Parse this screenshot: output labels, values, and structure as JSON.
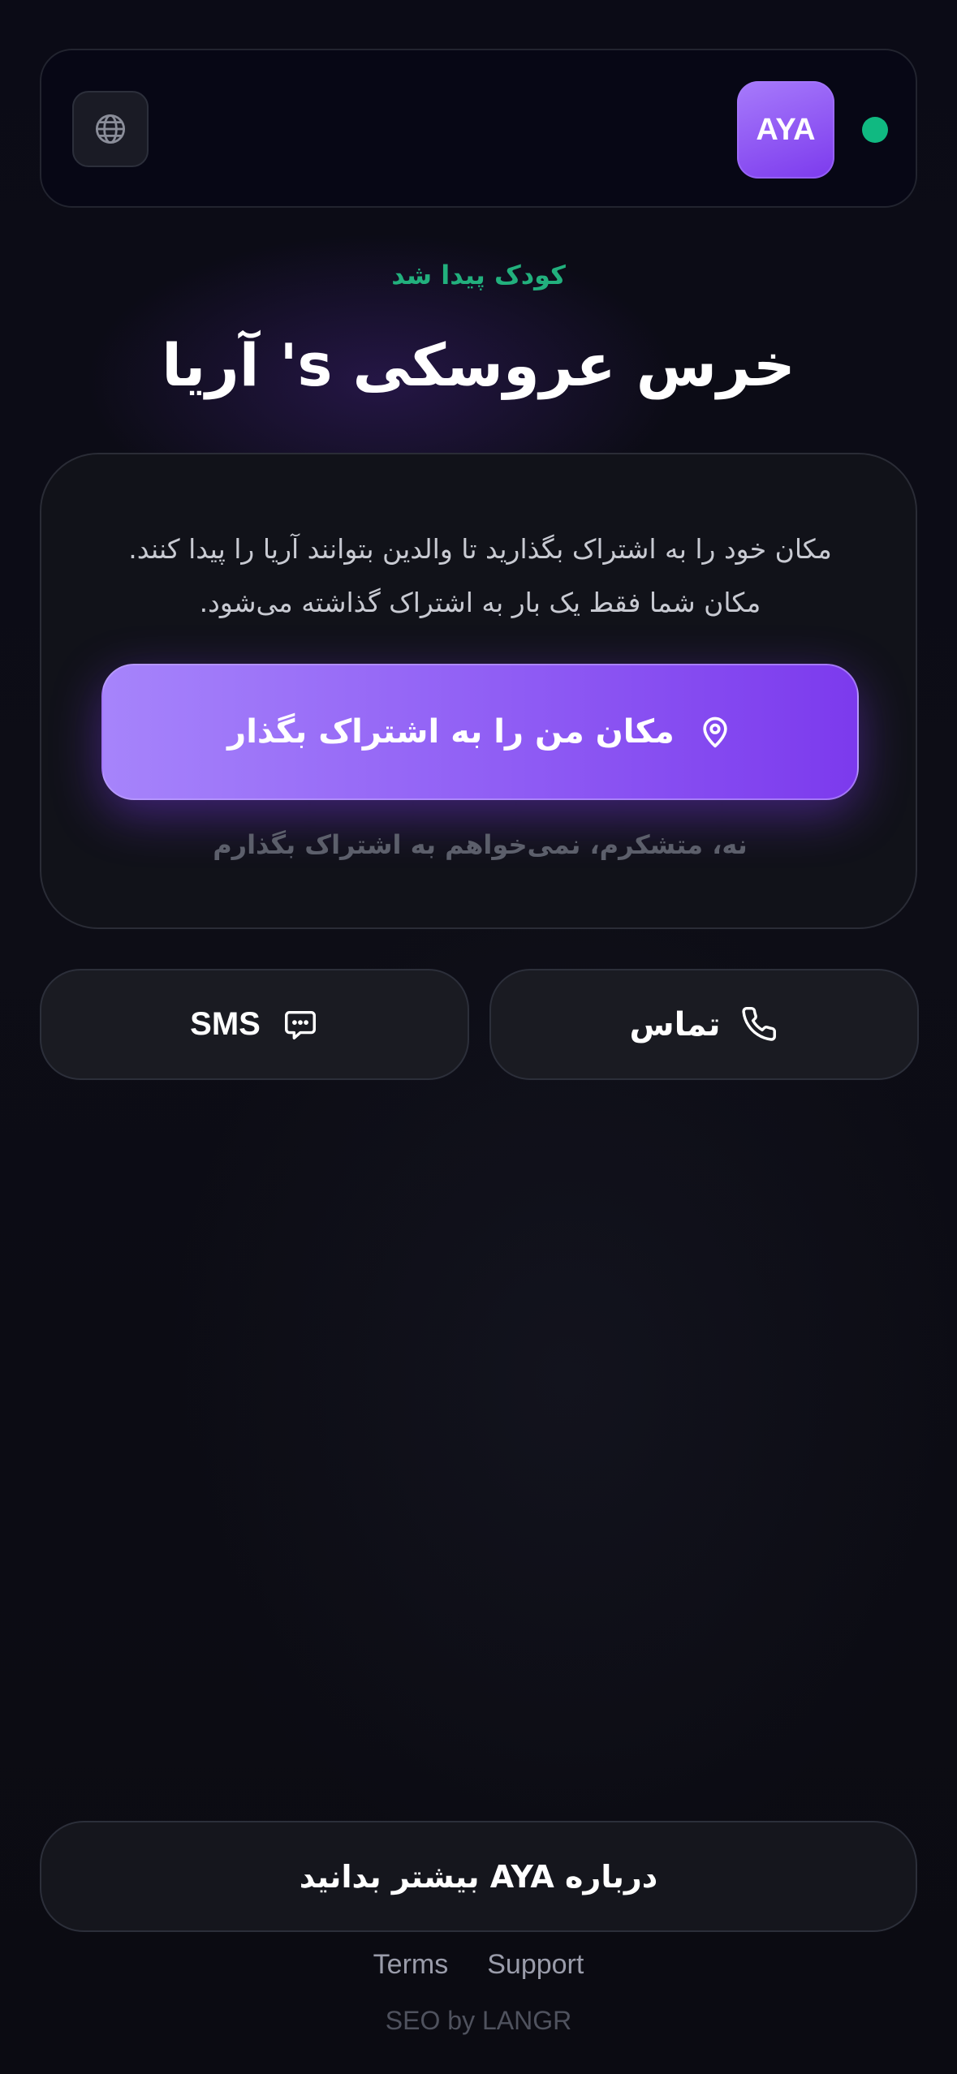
{
  "colors": {
    "accent": "#8b5cf6",
    "accent_dark": "#7c3aed",
    "success": "#22b07d",
    "status_online": "#10b981",
    "background": "#0b0b14"
  },
  "header": {
    "language_icon": "globe-icon",
    "logo_text": "AYA",
    "status": "online"
  },
  "main": {
    "found_label": "کودک پیدا شد",
    "title": "آریا 's خرس عروسکی",
    "share_card": {
      "description": "مکان خود را به اشتراک بگذارید تا والدین بتوانند آریا را پیدا کنند. مکان شما فقط یک بار به اشتراک گذاشته می‌شود.",
      "share_button_label": "مکان من را به اشتراک بگذار",
      "share_button_icon": "map-pin-icon",
      "decline_label": "نه، متشکرم، نمی‌خواهم به اشتراک بگذارم"
    },
    "actions": {
      "sms_label": "SMS",
      "sms_icon": "message-dots-icon",
      "call_label": "تماس",
      "call_icon": "phone-icon"
    }
  },
  "footer": {
    "learn_more_label": "درباره AYA بیشتر بدانید",
    "links": {
      "terms": "Terms",
      "support": "Support"
    },
    "seo_credit": "SEO by LANGR"
  }
}
